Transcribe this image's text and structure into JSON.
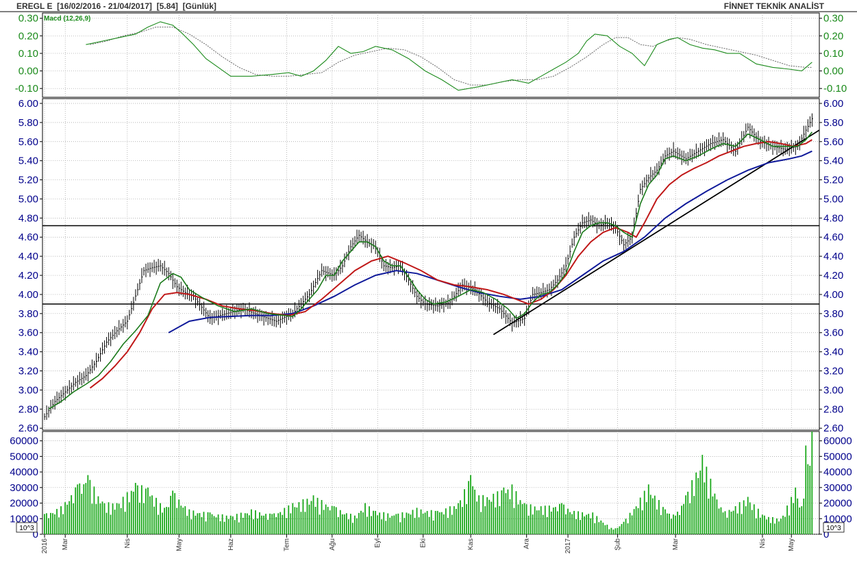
{
  "header": {
    "title": "EREGL E  [16/02/2016 - 21/04/2017]  [5.84]  [Günlük]",
    "brand": "FİNNET TEKNİK ANALİST"
  },
  "colors": {
    "price_bars": "#000000",
    "ma_short": "#1a7a1a",
    "ma_mid": "#c01818",
    "ma_long": "#101a9a",
    "macd_line": "#1a8a1a",
    "macd_signal": "#666666",
    "volume": "#1aa81a",
    "axis_text_top": "#1a8a1a",
    "axis_text_main": "#00008b",
    "grid": "#9a9a9a"
  },
  "chart_data": [
    {
      "type": "line",
      "panel": "macd",
      "title": "Macd (12,26,9)",
      "ylim": [
        -0.15,
        0.33
      ],
      "yticks": [
        0.3,
        0.2,
        0.1,
        0.0,
        -0.1
      ],
      "ytick_labels": [
        "0.30",
        "0.20",
        "0.10",
        "0.00",
        "-0.10"
      ],
      "x_unit": "trading day index (0 = 16/02/2016)",
      "series": [
        {
          "role": "macd",
          "x": [
            20,
            28,
            36,
            44,
            50,
            56,
            62,
            66,
            72,
            78,
            84,
            90,
            100,
            110,
            118,
            124,
            130,
            136,
            142,
            148,
            154,
            160,
            168,
            176,
            184,
            192,
            200,
            210,
            218,
            226,
            234,
            240,
            246,
            252,
            258,
            262,
            266,
            272,
            278,
            284,
            290,
            296,
            302,
            306,
            312,
            318,
            324,
            330,
            336,
            344,
            352,
            360,
            366,
            371
          ],
          "values": [
            0.15,
            0.17,
            0.19,
            0.21,
            0.25,
            0.28,
            0.26,
            0.22,
            0.15,
            0.07,
            0.02,
            -0.03,
            -0.03,
            -0.02,
            -0.01,
            -0.03,
            0.0,
            0.06,
            0.14,
            0.1,
            0.11,
            0.14,
            0.12,
            0.07,
            0.0,
            -0.05,
            -0.11,
            -0.09,
            -0.07,
            -0.05,
            -0.07,
            -0.03,
            0.01,
            0.05,
            0.1,
            0.17,
            0.21,
            0.2,
            0.14,
            0.1,
            0.03,
            0.15,
            0.18,
            0.19,
            0.15,
            0.13,
            0.12,
            0.1,
            0.1,
            0.04,
            0.02,
            0.01,
            0.0,
            0.05
          ]
        },
        {
          "role": "signal",
          "x": [
            22,
            30,
            38,
            46,
            54,
            62,
            70,
            78,
            86,
            94,
            102,
            110,
            118,
            126,
            134,
            142,
            150,
            158,
            166,
            174,
            182,
            190,
            198,
            206,
            214,
            222,
            230,
            238,
            246,
            254,
            262,
            270,
            276,
            282,
            288,
            294,
            300,
            306,
            312,
            320,
            328,
            336,
            344,
            352,
            360,
            368,
            371
          ],
          "values": [
            0.15,
            0.17,
            0.2,
            0.22,
            0.25,
            0.25,
            0.21,
            0.15,
            0.08,
            0.02,
            -0.02,
            -0.03,
            -0.03,
            -0.02,
            -0.01,
            0.05,
            0.09,
            0.11,
            0.13,
            0.12,
            0.08,
            0.02,
            -0.05,
            -0.08,
            -0.08,
            -0.06,
            -0.05,
            -0.05,
            -0.03,
            0.02,
            0.08,
            0.15,
            0.19,
            0.19,
            0.15,
            0.14,
            0.17,
            0.19,
            0.18,
            0.15,
            0.13,
            0.11,
            0.09,
            0.06,
            0.03,
            0.02,
            0.02
          ]
        }
      ]
    },
    {
      "type": "line",
      "panel": "price",
      "ylim": [
        2.58,
        6.05
      ],
      "yticks": [
        6.0,
        5.8,
        5.6,
        5.4,
        5.2,
        5.0,
        4.8,
        4.6,
        4.4,
        4.2,
        4.0,
        3.8,
        3.6,
        3.4,
        3.2,
        3.0,
        2.8,
        2.6
      ],
      "ytick_labels": [
        "6.00",
        "5.80",
        "5.60",
        "5.40",
        "5.20",
        "5.00",
        "4.80",
        "4.60",
        "4.40",
        "4.20",
        "4.00",
        "3.80",
        "3.60",
        "3.40",
        "3.20",
        "3.00",
        "2.80",
        "2.60"
      ],
      "x_unit": "trading day index (0 = 16/02/2016)",
      "series": [
        {
          "role": "price_close",
          "x": [
            0,
            5,
            10,
            15,
            20,
            25,
            30,
            35,
            40,
            45,
            48,
            52,
            56,
            60,
            64,
            68,
            72,
            80,
            88,
            96,
            104,
            112,
            120,
            128,
            134,
            140,
            144,
            148,
            152,
            156,
            160,
            164,
            168,
            172,
            176,
            180,
            184,
            190,
            196,
            202,
            208,
            214,
            220,
            226,
            232,
            236,
            240,
            244,
            248,
            252,
            256,
            260,
            264,
            268,
            272,
            276,
            280,
            284,
            288,
            292,
            296,
            300,
            304,
            310,
            316,
            322,
            328,
            334,
            340,
            346,
            352,
            358,
            364,
            368,
            371
          ],
          "values": [
            2.72,
            2.88,
            2.98,
            3.08,
            3.15,
            3.3,
            3.5,
            3.62,
            3.72,
            4.05,
            4.25,
            4.28,
            4.3,
            4.22,
            4.08,
            4.02,
            3.98,
            3.75,
            3.8,
            3.85,
            3.78,
            3.72,
            3.8,
            4.0,
            4.25,
            4.2,
            4.3,
            4.5,
            4.62,
            4.55,
            4.5,
            4.3,
            4.28,
            4.3,
            4.15,
            3.98,
            3.9,
            3.88,
            3.92,
            4.1,
            4.05,
            3.92,
            3.85,
            3.7,
            3.75,
            4.0,
            4.02,
            4.05,
            4.15,
            4.3,
            4.6,
            4.75,
            4.78,
            4.72,
            4.75,
            4.7,
            4.52,
            4.6,
            5.1,
            5.22,
            5.3,
            5.45,
            5.5,
            5.42,
            5.5,
            5.58,
            5.62,
            5.5,
            5.75,
            5.6,
            5.55,
            5.52,
            5.55,
            5.72,
            5.84
          ]
        },
        {
          "role": "ma_short",
          "x": [
            2,
            8,
            14,
            20,
            26,
            32,
            38,
            44,
            50,
            56,
            62,
            66,
            70,
            76,
            84,
            92,
            100,
            108,
            116,
            120,
            124,
            128,
            132,
            136,
            140,
            144,
            148,
            152,
            156,
            160,
            164,
            168,
            172,
            176,
            180,
            184,
            188,
            194,
            200,
            206,
            212,
            218,
            224,
            228,
            232,
            236,
            240,
            244,
            248,
            252,
            256,
            260,
            264,
            268,
            272,
            276,
            280,
            284,
            288,
            292,
            296,
            300,
            304,
            310,
            316,
            322,
            328,
            334,
            340,
            346,
            352,
            358,
            364,
            368,
            371
          ],
          "values": [
            2.8,
            2.88,
            2.98,
            3.06,
            3.15,
            3.3,
            3.48,
            3.62,
            3.78,
            4.12,
            4.22,
            4.18,
            4.05,
            3.97,
            3.88,
            3.82,
            3.85,
            3.8,
            3.78,
            3.77,
            3.85,
            3.95,
            4.05,
            4.2,
            4.2,
            4.35,
            4.45,
            4.55,
            4.55,
            4.5,
            4.35,
            4.3,
            4.3,
            4.18,
            4.05,
            3.95,
            3.9,
            3.92,
            3.98,
            4.05,
            4.02,
            3.95,
            3.85,
            3.75,
            3.8,
            3.92,
            4.0,
            4.02,
            4.1,
            4.22,
            4.45,
            4.65,
            4.72,
            4.75,
            4.75,
            4.72,
            4.65,
            4.6,
            4.95,
            5.15,
            5.25,
            5.42,
            5.45,
            5.4,
            5.45,
            5.52,
            5.58,
            5.55,
            5.68,
            5.62,
            5.55,
            5.55,
            5.55,
            5.62,
            5.7
          ]
        },
        {
          "role": "ma_mid",
          "x": [
            22,
            28,
            34,
            40,
            46,
            52,
            58,
            64,
            70,
            78,
            86,
            94,
            102,
            110,
            118,
            126,
            134,
            142,
            150,
            158,
            166,
            174,
            182,
            190,
            198,
            206,
            214,
            222,
            228,
            234,
            240,
            246,
            252,
            258,
            264,
            270,
            276,
            282,
            286,
            290,
            296,
            302,
            308,
            314,
            320,
            326,
            332,
            338,
            344,
            350,
            356,
            362,
            368,
            371
          ],
          "values": [
            3.02,
            3.12,
            3.25,
            3.4,
            3.6,
            3.85,
            4.0,
            4.02,
            4.0,
            3.95,
            3.88,
            3.85,
            3.83,
            3.8,
            3.78,
            3.82,
            3.95,
            4.1,
            4.25,
            4.35,
            4.4,
            4.33,
            4.25,
            4.15,
            4.1,
            4.08,
            4.05,
            4.0,
            3.95,
            3.9,
            3.95,
            4.05,
            4.2,
            4.4,
            4.55,
            4.65,
            4.7,
            4.65,
            4.6,
            4.75,
            5.0,
            5.15,
            5.25,
            5.32,
            5.38,
            5.45,
            5.5,
            5.55,
            5.58,
            5.6,
            5.58,
            5.55,
            5.58,
            5.62
          ]
        },
        {
          "role": "ma_long",
          "x": [
            60,
            70,
            80,
            90,
            100,
            110,
            120,
            130,
            140,
            150,
            160,
            170,
            180,
            190,
            200,
            210,
            220,
            230,
            240,
            250,
            260,
            270,
            280,
            290,
            300,
            310,
            320,
            330,
            340,
            350,
            360,
            366,
            371
          ],
          "values": [
            3.6,
            3.72,
            3.76,
            3.77,
            3.78,
            3.78,
            3.8,
            3.88,
            3.98,
            4.1,
            4.2,
            4.25,
            4.22,
            4.15,
            4.08,
            4.02,
            3.98,
            3.95,
            3.98,
            4.05,
            4.2,
            4.35,
            4.45,
            4.6,
            4.8,
            4.95,
            5.08,
            5.2,
            5.3,
            5.38,
            5.42,
            5.45,
            5.5
          ]
        }
      ],
      "horizontal_lines": [
        4.72,
        3.9
      ],
      "trendline": {
        "x": [
          217,
          375
        ],
        "y": [
          3.58,
          5.72
        ]
      }
    },
    {
      "type": "bar",
      "panel": "volume",
      "ylim": [
        0,
        66000
      ],
      "yticks": [
        60000,
        50000,
        40000,
        30000,
        20000,
        10000,
        0
      ],
      "ytick_labels": [
        "60000",
        "50000",
        "40000",
        "30000",
        "20000",
        "10000",
        "0"
      ],
      "unit_label": "10^3",
      "x_unit": "trading day index (0 = 16/02/2016)",
      "x": [
        0,
        8,
        16,
        21,
        28,
        35,
        44,
        50,
        58,
        62,
        70,
        80,
        90,
        100,
        110,
        120,
        130,
        140,
        150,
        155,
        160,
        170,
        180,
        190,
        200,
        206,
        210,
        217,
        222,
        226,
        232,
        240,
        250,
        256,
        265,
        275,
        280,
        292,
        300,
        305,
        310,
        318,
        328,
        340,
        348,
        356,
        363,
        366,
        368,
        369,
        370,
        371
      ],
      "values": [
        13000,
        18000,
        32000,
        38000,
        21000,
        20000,
        33000,
        30000,
        17000,
        28000,
        16000,
        14000,
        12000,
        16000,
        13000,
        20000,
        25000,
        18000,
        12000,
        20000,
        15000,
        13000,
        17000,
        15000,
        20000,
        38000,
        25000,
        26000,
        30000,
        32000,
        20000,
        18000,
        20000,
        15000,
        14000,
        3000,
        8000,
        32000,
        16000,
        12000,
        25000,
        51000,
        14000,
        24000,
        12000,
        10000,
        30000,
        18000,
        57000,
        45000,
        44000,
        66000
      ]
    }
  ],
  "x_axis": {
    "tick_labels": [
      "2016",
      "Mar",
      "Nis",
      "May",
      "Haz",
      "Tem",
      "Ağu",
      "Eyl",
      "Eki",
      "Kas",
      "Ara",
      "2017",
      "Şub",
      "Mar",
      "Nis",
      "May"
    ],
    "tick_x": [
      0,
      10,
      40,
      65,
      90,
      117,
      139,
      161,
      183,
      206,
      233,
      253,
      277,
      305,
      347,
      361
    ]
  }
}
